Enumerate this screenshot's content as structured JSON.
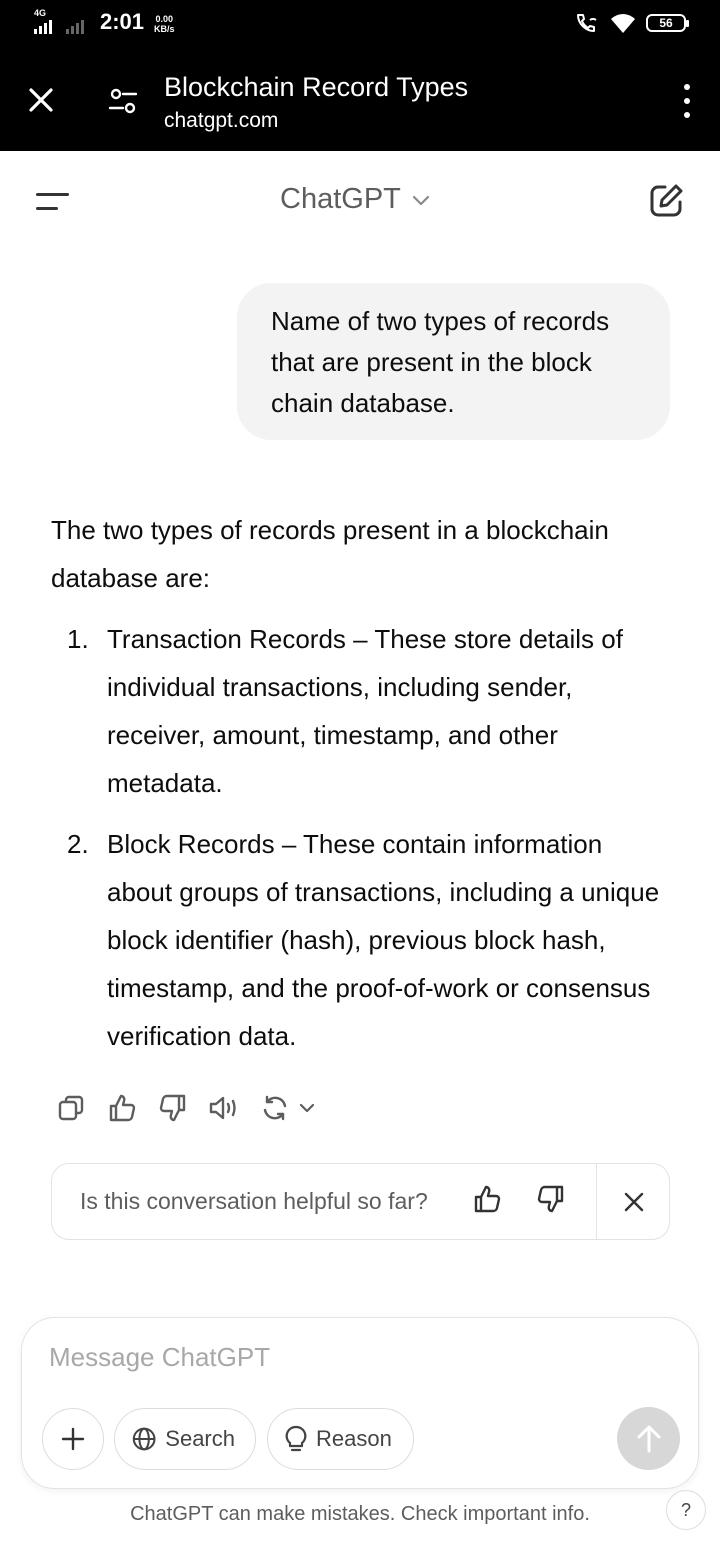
{
  "status_bar": {
    "network": "4G",
    "time": "2:01",
    "speed_value": "0.00",
    "speed_unit": "KB/s",
    "battery": "56"
  },
  "browser": {
    "page_title": "Blockchain Record Types",
    "url": "chatgpt.com"
  },
  "header": {
    "model_label": "ChatGPT"
  },
  "conversation": {
    "user_message": "Name of two types of records that are present in the block chain database.",
    "assistant_intro": "The two types of records present in a blockchain database are:",
    "assistant_items": [
      {
        "number": "1.",
        "text": "Transaction Records – These store details of individual transactions, including sender, receiver, amount, timestamp, and other metadata."
      },
      {
        "number": "2.",
        "text": "Block Records – These contain information about groups of transactions, including a unique block identifier (hash), previous block hash, timestamp, and the proof-of-work or consensus verification data."
      }
    ]
  },
  "feedback": {
    "question": "Is this conversation helpful so far?"
  },
  "composer": {
    "placeholder": "Message ChatGPT",
    "search_label": "Search",
    "reason_label": "Reason"
  },
  "footer": {
    "disclaimer": "ChatGPT can make mistakes. Check important info.",
    "help_label": "?"
  },
  "colors": {
    "status_bg": "#000000",
    "bubble_bg": "#f3f3f3",
    "text_primary": "#0d0d0d",
    "text_secondary": "#5d5d5d",
    "send_disabled": "#d7d7d7"
  },
  "icons": {
    "browser": [
      "close-icon",
      "tune-icon",
      "more-vert-icon"
    ],
    "header": [
      "menu-icon",
      "chevron-down-icon",
      "new-chat-icon"
    ],
    "actions": [
      "copy-icon",
      "thumbs-up-icon",
      "thumbs-down-icon",
      "read-aloud-icon",
      "regenerate-icon",
      "chevron-down-icon"
    ],
    "composer": [
      "plus-icon",
      "globe-icon",
      "lightbulb-icon",
      "arrow-up-icon"
    ]
  }
}
